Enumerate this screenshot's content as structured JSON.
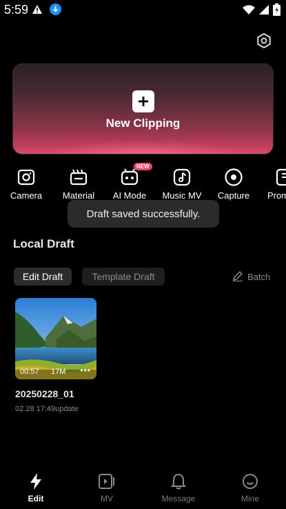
{
  "status_bar": {
    "time": "5:59"
  },
  "new_clipping": {
    "label": "New Clipping"
  },
  "tools": [
    {
      "label": "Camera",
      "icon": "camera-icon"
    },
    {
      "label": "Material",
      "icon": "material-icon"
    },
    {
      "label": "AI Mode",
      "icon": "ai-robot-icon",
      "badge": "NEW"
    },
    {
      "label": "Music MV",
      "icon": "music-mv-icon"
    },
    {
      "label": "Capture",
      "icon": "capture-icon"
    },
    {
      "label": "Prom",
      "icon": "prompter-icon"
    }
  ],
  "toast": {
    "text": "Draft saved successfully."
  },
  "local_draft": {
    "title": "Local Draft",
    "tabs": [
      "Edit Draft",
      "Template Draft"
    ],
    "batch_label": "Batch",
    "drafts": [
      {
        "duration": "00:57",
        "size": "17M",
        "name": "20250228_01",
        "date": "02.28 17:49update"
      }
    ]
  },
  "bottom_nav": [
    {
      "label": "Edit",
      "icon": "lightning-icon",
      "active": true
    },
    {
      "label": "MV",
      "icon": "mv-icon",
      "active": false
    },
    {
      "label": "Message",
      "icon": "bell-icon",
      "active": false
    },
    {
      "label": "Mine",
      "icon": "smile-icon",
      "active": false
    }
  ],
  "colors": {
    "accent": "#d84f6e",
    "badge": "#e8446a",
    "background": "#000000"
  }
}
